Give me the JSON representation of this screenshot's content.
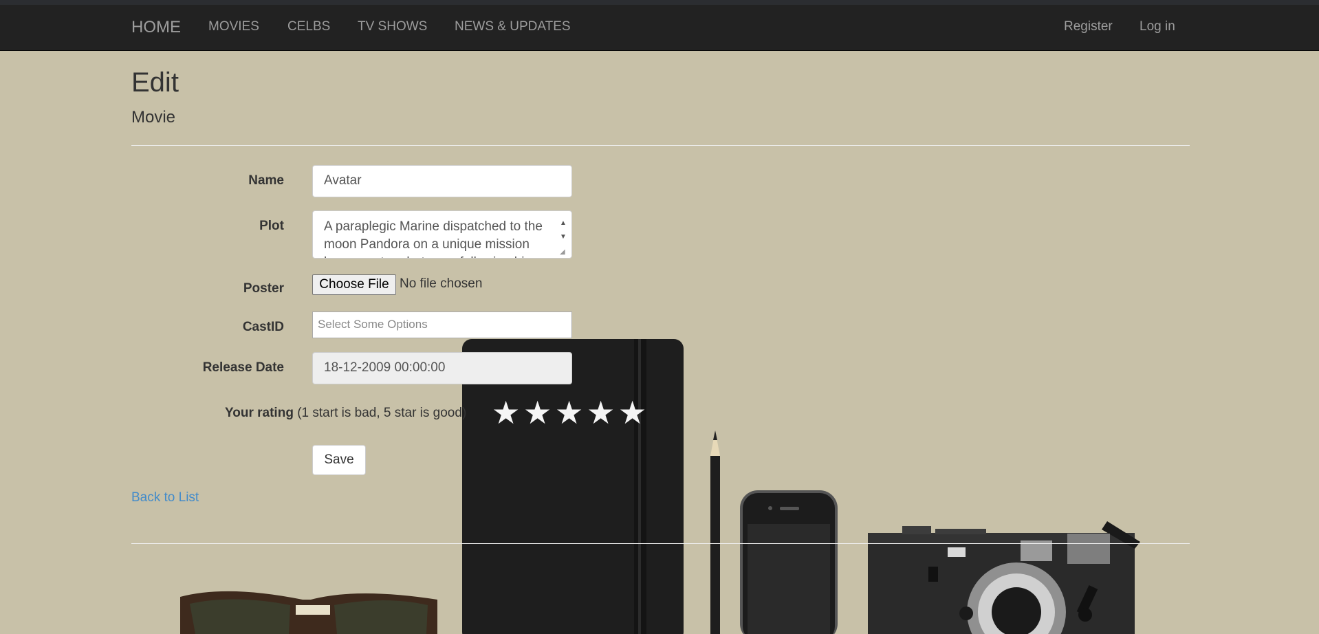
{
  "nav": {
    "brand": "HOME",
    "items": [
      "MOVIES",
      "CELBS",
      "TV SHOWS",
      "NEWS & UPDATES"
    ],
    "register": "Register",
    "login": "Log in"
  },
  "page": {
    "title": "Edit",
    "subtitle": "Movie"
  },
  "form": {
    "name_label": "Name",
    "name_value": "Avatar",
    "plot_label": "Plot",
    "plot_value": "A paraplegic Marine dispatched to the moon Pandora on a unique mission becomes torn between following his",
    "poster_label": "Poster",
    "choose_file": "Choose File",
    "no_file": "No file chosen",
    "cast_label": "CastID",
    "cast_placeholder": "Select Some Options",
    "release_label": "Release Date",
    "release_value": "18-12-2009 00:00:00",
    "rating_label": "Your rating",
    "rating_hint": "(1 start is bad, 5 star is good)",
    "stars": [
      "★",
      "★",
      "★",
      "★",
      "★"
    ],
    "save": "Save"
  },
  "back_link": "Back to List",
  "colors": {
    "background": "#c8c1a8",
    "navbar": "#222222",
    "link": "#428bca"
  }
}
